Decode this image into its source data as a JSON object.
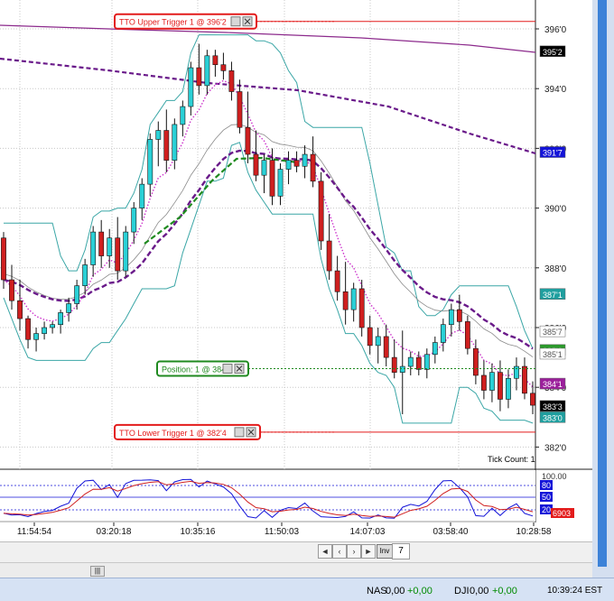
{
  "chart_data": {
    "type": "candlestick",
    "y_ticks": [
      "396'0",
      "394'0",
      "392'0",
      "390'0",
      "388'0",
      "386'0",
      "384'0",
      "382'0"
    ],
    "x_ticks": [
      "11:54:54",
      "03:20:18",
      "10:35:16",
      "11:50:03",
      "14:07:03",
      "03:58:40",
      "10:28:58"
    ],
    "price_tags": [
      {
        "label": "395'2",
        "bg": "#000000",
        "fg": "#ffffff",
        "y": 395.25
      },
      {
        "label": "391'7",
        "bg": "#1414d8",
        "fg": "#ffffff",
        "y": 391.875
      },
      {
        "label": "387'1",
        "bg": "#1f9f9f",
        "fg": "#ffffff",
        "y": 387.125
      },
      {
        "label": "385'7",
        "bg": "#ffffff",
        "fg": "#555555",
        "y": 385.875
      },
      {
        "label": "385'2",
        "bg": "#2a9a2a",
        "fg": "#ffffff",
        "y": 385.25
      },
      {
        "label": "385'1",
        "bg": "#ffffff",
        "fg": "#555555",
        "y": 385.125
      },
      {
        "label": "384'1",
        "bg": "#9b1f9b",
        "fg": "#ffffff",
        "y": 384.125
      },
      {
        "label": "383'3",
        "bg": "#000000",
        "fg": "#ffffff",
        "y": 383.375
      },
      {
        "label": "383'0",
        "bg": "#1f9f9f",
        "fg": "#ffffff",
        "y": 383.0
      }
    ],
    "orders": [
      {
        "label": "TTO Upper Trigger 1 @ 396'2",
        "price": 396.25,
        "color": "#e31b1b"
      },
      {
        "label": "Position: 1 @ 384'5",
        "price": 384.625,
        "color": "#1f8a1f"
      },
      {
        "label": "TTO Lower Trigger 1 @ 382'4",
        "price": 382.5,
        "color": "#e31b1b"
      }
    ],
    "tick_count_label": "Tick Count:  1",
    "indicator_ticks": [
      {
        "label": "100.00",
        "bg": "#ffffff",
        "fg": "#333333"
      },
      {
        "label": "80",
        "bg": "#1414d8",
        "fg": "#ffffff"
      },
      {
        "label": "50",
        "bg": "#1414d8",
        "fg": "#ffffff"
      },
      {
        "label": "20",
        "bg": "#1414d8",
        "fg": "#ffffff"
      },
      {
        "label": "6903",
        "bg": "#e31b1b",
        "fg": "#ffffff"
      }
    ],
    "candles": [
      [
        389.0,
        389.2,
        387.3,
        387.6
      ],
      [
        387.6,
        388.1,
        386.6,
        386.9
      ],
      [
        386.9,
        387.6,
        385.9,
        386.3
      ],
      [
        386.3,
        386.4,
        385.3,
        385.6
      ],
      [
        385.6,
        386.0,
        385.2,
        385.8
      ],
      [
        385.8,
        386.2,
        385.6,
        386.0
      ],
      [
        386.0,
        386.2,
        385.8,
        386.1
      ],
      [
        386.1,
        386.6,
        385.8,
        386.5
      ],
      [
        386.5,
        387.0,
        386.2,
        386.8
      ],
      [
        386.8,
        387.6,
        386.6,
        387.4
      ],
      [
        387.4,
        388.3,
        387.1,
        388.1
      ],
      [
        388.1,
        389.4,
        387.7,
        389.2
      ],
      [
        389.2,
        389.6,
        388.0,
        388.4
      ],
      [
        388.4,
        389.3,
        388.0,
        389.0
      ],
      [
        389.0,
        389.7,
        387.6,
        387.9
      ],
      [
        387.9,
        389.4,
        387.7,
        389.2
      ],
      [
        389.2,
        390.2,
        388.8,
        390.0
      ],
      [
        390.0,
        391.0,
        389.6,
        390.8
      ],
      [
        390.8,
        392.5,
        390.4,
        392.3
      ],
      [
        392.3,
        392.9,
        391.4,
        392.6
      ],
      [
        392.6,
        393.3,
        391.2,
        391.6
      ],
      [
        391.6,
        393.0,
        391.3,
        392.8
      ],
      [
        392.8,
        393.6,
        392.4,
        393.4
      ],
      [
        393.4,
        394.9,
        393.1,
        394.7
      ],
      [
        394.7,
        395.5,
        393.8,
        394.1
      ],
      [
        394.1,
        395.3,
        393.8,
        395.1
      ],
      [
        395.1,
        395.3,
        394.4,
        394.8
      ],
      [
        394.8,
        395.2,
        394.3,
        394.6
      ],
      [
        394.6,
        394.9,
        393.6,
        393.9
      ],
      [
        393.9,
        394.3,
        392.5,
        392.7
      ],
      [
        392.7,
        393.9,
        391.5,
        391.8
      ],
      [
        391.8,
        392.6,
        390.9,
        391.1
      ],
      [
        391.1,
        391.8,
        390.5,
        391.6
      ],
      [
        391.6,
        392.0,
        390.1,
        390.4
      ],
      [
        390.4,
        391.5,
        390.1,
        391.3
      ],
      [
        391.3,
        391.9,
        390.8,
        391.6
      ],
      [
        391.6,
        391.9,
        391.2,
        391.4
      ],
      [
        391.4,
        392.1,
        391.0,
        391.8
      ],
      [
        391.8,
        392.4,
        390.7,
        390.9
      ],
      [
        390.9,
        391.2,
        388.6,
        388.9
      ],
      [
        388.9,
        389.8,
        387.6,
        387.9
      ],
      [
        387.9,
        388.4,
        386.9,
        387.2
      ],
      [
        387.2,
        388.2,
        386.1,
        386.6
      ],
      [
        386.6,
        387.5,
        386.2,
        387.3
      ],
      [
        387.3,
        387.6,
        385.7,
        386.0
      ],
      [
        386.0,
        386.4,
        385.1,
        385.4
      ],
      [
        385.4,
        386.0,
        384.8,
        385.7
      ],
      [
        385.7,
        386.1,
        384.7,
        385.0
      ],
      [
        385.0,
        385.6,
        384.3,
        384.5
      ],
      [
        384.5,
        385.9,
        383.1,
        384.7
      ],
      [
        384.7,
        385.2,
        384.4,
        385.0
      ],
      [
        385.0,
        385.2,
        384.4,
        384.6
      ],
      [
        384.6,
        385.3,
        384.3,
        385.1
      ],
      [
        385.1,
        385.7,
        384.8,
        385.5
      ],
      [
        385.5,
        386.3,
        385.2,
        386.1
      ],
      [
        386.1,
        386.8,
        385.7,
        386.6
      ],
      [
        386.6,
        387.1,
        385.9,
        386.2
      ],
      [
        386.2,
        386.4,
        385.1,
        385.3
      ],
      [
        385.3,
        385.6,
        384.1,
        384.4
      ],
      [
        384.4,
        384.9,
        383.6,
        383.9
      ],
      [
        383.9,
        384.8,
        383.5,
        384.5
      ],
      [
        384.5,
        384.9,
        383.2,
        383.6
      ],
      [
        383.6,
        384.6,
        383.3,
        384.3
      ],
      [
        384.3,
        385.0,
        383.9,
        384.7
      ],
      [
        384.7,
        385.0,
        383.6,
        383.8
      ],
      [
        383.8,
        384.2,
        383.1,
        383.4
      ]
    ]
  },
  "tabbar": {
    "nav_prev": "◄",
    "nav_next": "►",
    "nav_left": "‹",
    "nav_right": "›",
    "current_tab": "Inv",
    "tab_7": "7"
  },
  "status": {
    "nas_label": "NAS",
    "nas_value": "0,00",
    "nas_change": "+0,00",
    "dji_label": "DJI",
    "dji_value": "0,00",
    "dji_change": "+0,00",
    "clock": "10:39:24 EST"
  }
}
